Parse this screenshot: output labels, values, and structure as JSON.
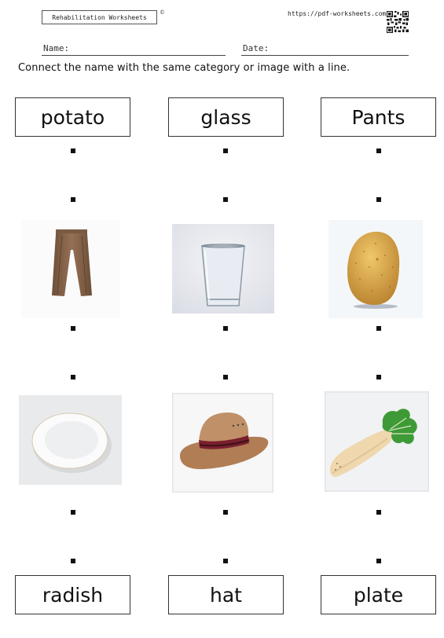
{
  "header": {
    "title": "Rehabilitation Worksheets",
    "copyright_symbol": "©",
    "url": "https://pdf-worksheets.com",
    "qr_icon": "qr-code-icon"
  },
  "fields": {
    "name_label": "Name:",
    "date_label": "Date:"
  },
  "instructions": "Connect the name with the same category or image with a line.",
  "top_words": [
    {
      "label": "potato"
    },
    {
      "label": "glass"
    },
    {
      "label": "Pants"
    }
  ],
  "image_row_1": [
    {
      "subject": "pants",
      "icon": "pants-image"
    },
    {
      "subject": "glass",
      "icon": "glass-image"
    },
    {
      "subject": "potato",
      "icon": "potato-image"
    }
  ],
  "image_row_2": [
    {
      "subject": "plate",
      "icon": "plate-image"
    },
    {
      "subject": "hat",
      "icon": "hat-image"
    },
    {
      "subject": "radish",
      "icon": "radish-image"
    }
  ],
  "bottom_words": [
    {
      "label": "radish"
    },
    {
      "label": "hat"
    },
    {
      "label": "plate"
    }
  ],
  "colors": {
    "ink": "#111111",
    "border": "#333333",
    "pants": "#8a6a4e",
    "potato": "#d9a64a",
    "hat": "#b9875e",
    "hat_band": "#7a1f2e",
    "radish_leaf": "#3e9a36"
  }
}
